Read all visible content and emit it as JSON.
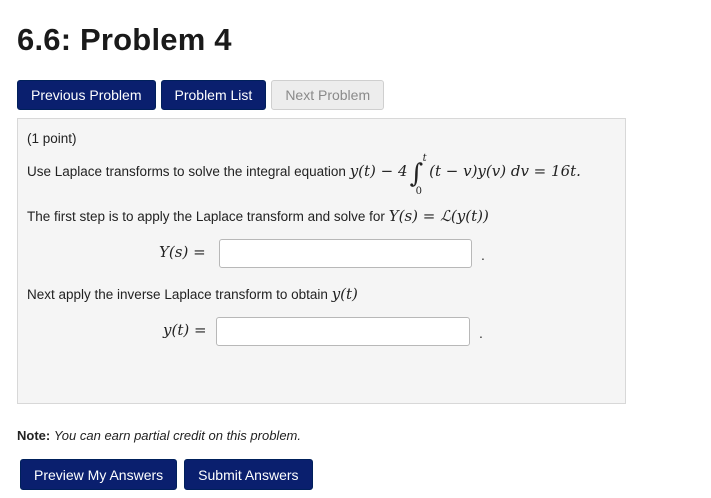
{
  "page": {
    "title": "6.6: Problem 4"
  },
  "nav": {
    "previous_label": "Previous Problem",
    "list_label": "Problem List",
    "next_label": "Next Problem"
  },
  "problem": {
    "points": "(1 point)",
    "intro": "Use Laplace transforms to solve the integral equation",
    "eq_lhs": "y(t) − 4",
    "integral_upper": "t",
    "integral_lower": "0",
    "eq_rhs": "(t − v)y(v) dv = 16t",
    "step1_text": "The first step is to apply the Laplace transform and solve for",
    "step1_math": "Y(s) = ℒ(y(t))",
    "answer1_label": "Y(s) =",
    "answer1_value": "",
    "step2_text": "Next apply the inverse Laplace transform to obtain",
    "step2_math": "y(t)",
    "answer2_label": "y(t) =",
    "answer2_value": "",
    "period": "."
  },
  "note": {
    "label": "Note:",
    "text": "You can earn partial credit on this problem."
  },
  "actions": {
    "preview_label": "Preview My Answers",
    "submit_label": "Submit Answers"
  }
}
